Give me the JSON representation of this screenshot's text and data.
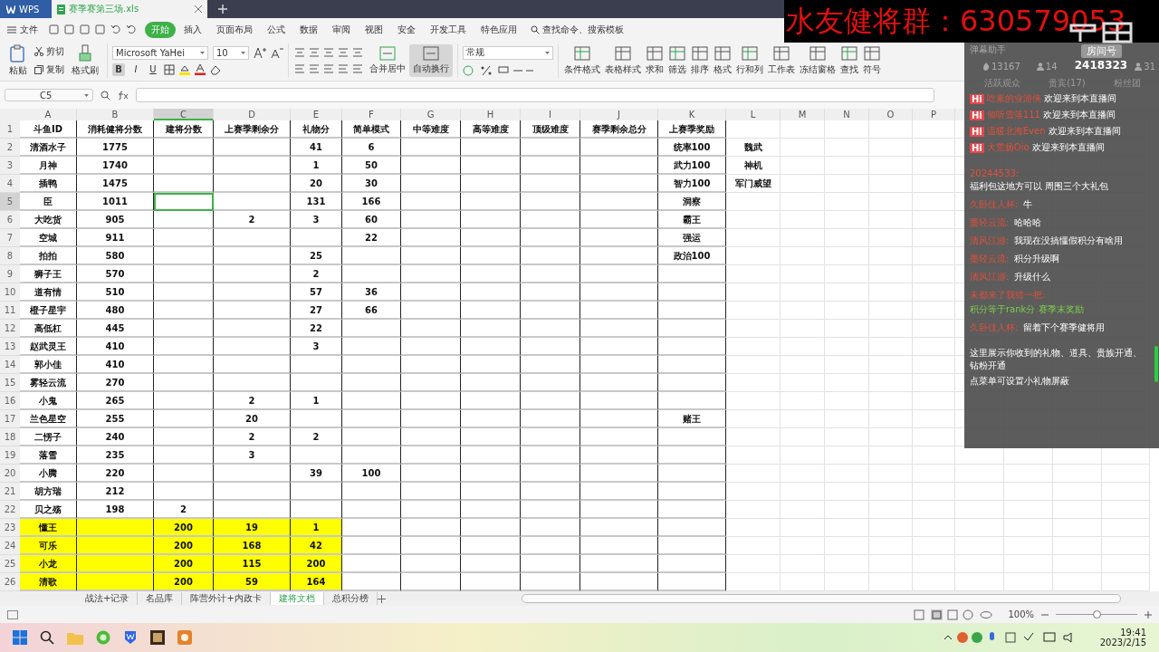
{
  "tabs": {
    "app": "WPS",
    "file": "赛季赛第三场.xls"
  },
  "banner": "水友健将群：630579053",
  "menu": {
    "file": "文件",
    "items": [
      {
        "label": "开始",
        "selected": true
      },
      {
        "label": "插入",
        "selected": false
      },
      {
        "label": "页面布局",
        "selected": false
      },
      {
        "label": "公式",
        "selected": false
      },
      {
        "label": "数据",
        "selected": false
      },
      {
        "label": "审阅",
        "selected": false
      },
      {
        "label": "视图",
        "selected": false
      },
      {
        "label": "安全",
        "selected": false
      },
      {
        "label": "开发工具",
        "selected": false
      },
      {
        "label": "特色应用",
        "selected": false
      }
    ],
    "search": "查找命令、搜索模板"
  },
  "ribbon": {
    "paste": "粘贴",
    "cut": "剪切",
    "copy": "复制",
    "format_painter": "格式刷",
    "font": "Microsoft YaHei",
    "size": "10",
    "format_buttons": [
      {
        "label": "B",
        "pressed": true
      },
      {
        "label": "I",
        "pressed": false
      },
      {
        "label": "U",
        "pressed": false
      }
    ],
    "align_buttons": [
      {
        "label": "合并居中",
        "pressed": false
      },
      {
        "label": "自动换行",
        "pressed": true
      }
    ],
    "number_format": "常规",
    "tools": [
      "条件格式",
      "表格样式",
      "求和",
      "筛选",
      "排序",
      "格式",
      "行和列",
      "工作表",
      "冻结窗格",
      "查找",
      "符号"
    ]
  },
  "formula_bar": {
    "name_box": "C5"
  },
  "sheet": {
    "columns": [
      {
        "letter": "A",
        "selected": false
      },
      {
        "letter": "B",
        "selected": false
      },
      {
        "letter": "C",
        "selected": true
      },
      {
        "letter": "D",
        "selected": false
      },
      {
        "letter": "E",
        "selected": false
      },
      {
        "letter": "F",
        "selected": false
      },
      {
        "letter": "G",
        "selected": false
      },
      {
        "letter": "H",
        "selected": false
      },
      {
        "letter": "I",
        "selected": false
      },
      {
        "letter": "J",
        "selected": false
      },
      {
        "letter": "K",
        "selected": false
      },
      {
        "letter": "L",
        "selected": false
      },
      {
        "letter": "M",
        "selected": false
      },
      {
        "letter": "N",
        "selected": false
      },
      {
        "letter": "O",
        "selected": false
      },
      {
        "letter": "P",
        "selected": false
      }
    ],
    "rows": [
      {
        "number": "1",
        "selected": false,
        "highlighted": false,
        "cells": {
          "A": "斗鱼ID",
          "B": "消耗健将分数",
          "C": "建将分数",
          "D": "上赛季剩余分",
          "E": "礼物分",
          "F": "简单模式",
          "G": "中等难度",
          "H": "高等难度",
          "I": "顶级难度",
          "J": "赛季剩余总分",
          "K": "上赛季奖励"
        }
      },
      {
        "number": "2",
        "selected": false,
        "highlighted": false,
        "cells": {
          "A": "清酒水子",
          "B": "1775",
          "E": "41",
          "F": "6",
          "K": "统率100",
          "L": "魏武"
        }
      },
      {
        "number": "3",
        "selected": false,
        "highlighted": false,
        "cells": {
          "A": "月神",
          "B": "1740",
          "E": "1",
          "F": "50",
          "K": "武力100",
          "L": "神机"
        }
      },
      {
        "number": "4",
        "selected": false,
        "highlighted": false,
        "cells": {
          "A": "插鸭",
          "B": "1475",
          "E": "20",
          "F": "30",
          "K": "智力100",
          "L": "军门威望"
        }
      },
      {
        "number": "5",
        "selected": true,
        "highlighted": false,
        "cells": {
          "A": "臣",
          "B": "1011",
          "E": "131",
          "F": "166",
          "K": "洞察"
        }
      },
      {
        "number": "6",
        "selected": false,
        "highlighted": false,
        "cells": {
          "A": "大吃货",
          "B": "905",
          "D": "2",
          "E": "3",
          "F": "60",
          "K": "霸王"
        }
      },
      {
        "number": "7",
        "selected": false,
        "highlighted": false,
        "cells": {
          "A": "空城",
          "B": "911",
          "F": "22",
          "K": "强运"
        }
      },
      {
        "number": "8",
        "selected": false,
        "highlighted": false,
        "cells": {
          "A": "拍拍",
          "B": "580",
          "E": "25",
          "K": "政治100"
        }
      },
      {
        "number": "9",
        "selected": false,
        "highlighted": false,
        "cells": {
          "A": "狮子王",
          "B": "570",
          "E": "2"
        }
      },
      {
        "number": "10",
        "selected": false,
        "highlighted": false,
        "cells": {
          "A": "道有情",
          "B": "510",
          "E": "57",
          "F": "36"
        }
      },
      {
        "number": "11",
        "selected": false,
        "highlighted": false,
        "cells": {
          "A": "橙子星宇",
          "B": "480",
          "E": "27",
          "F": "66"
        }
      },
      {
        "number": "12",
        "selected": false,
        "highlighted": false,
        "cells": {
          "A": "高低杠",
          "B": "445",
          "E": "22"
        }
      },
      {
        "number": "13",
        "selected": false,
        "highlighted": false,
        "cells": {
          "A": "赵武灵王",
          "B": "410",
          "E": "3"
        }
      },
      {
        "number": "14",
        "selected": false,
        "highlighted": false,
        "cells": {
          "A": "郭小佳",
          "B": "410"
        }
      },
      {
        "number": "15",
        "selected": false,
        "highlighted": false,
        "cells": {
          "A": "雾轻云流",
          "B": "270"
        }
      },
      {
        "number": "16",
        "selected": false,
        "highlighted": false,
        "cells": {
          "A": "小鬼",
          "B": "265",
          "D": "2",
          "E": "1"
        }
      },
      {
        "number": "17",
        "selected": false,
        "highlighted": false,
        "cells": {
          "A": "兰色星空",
          "B": "255",
          "D": "20",
          "K": "赌王"
        }
      },
      {
        "number": "18",
        "selected": false,
        "highlighted": false,
        "cells": {
          "A": "二愣子",
          "B": "240",
          "D": "2",
          "E": "2"
        }
      },
      {
        "number": "19",
        "selected": false,
        "highlighted": false,
        "cells": {
          "A": "落雪",
          "B": "235",
          "D": "3"
        }
      },
      {
        "number": "20",
        "selected": false,
        "highlighted": false,
        "cells": {
          "A": "小腾",
          "B": "220",
          "E": "39",
          "F": "100"
        }
      },
      {
        "number": "21",
        "selected": false,
        "highlighted": false,
        "cells": {
          "A": "胡方瑞",
          "B": "212"
        }
      },
      {
        "number": "22",
        "selected": false,
        "highlighted": false,
        "cells": {
          "A": "贝之殇",
          "B": "198",
          "C": "2"
        }
      },
      {
        "number": "23",
        "selected": false,
        "highlighted": true,
        "cells": {
          "A": "懂王",
          "C": "200",
          "D": "19",
          "E": "1"
        }
      },
      {
        "number": "24",
        "selected": false,
        "highlighted": true,
        "cells": {
          "A": "可乐",
          "C": "200",
          "D": "168",
          "E": "42"
        }
      },
      {
        "number": "25",
        "selected": false,
        "highlighted": true,
        "cells": {
          "A": "小龙",
          "C": "200",
          "D": "115",
          "E": "200"
        }
      },
      {
        "number": "26",
        "selected": false,
        "highlighted": true,
        "cells": {
          "A": "清歌",
          "C": "200",
          "D": "59",
          "E": "164"
        }
      }
    ]
  },
  "sheet_tabs": [
    {
      "label": "战法+记录",
      "selected": false
    },
    {
      "label": "名品库",
      "selected": false
    },
    {
      "label": "阵营外计+内政卡",
      "selected": false
    },
    {
      "label": "建将文档",
      "selected": true
    },
    {
      "label": "总积分榜",
      "selected": false
    }
  ],
  "status": {
    "zoom": "100%",
    "level": 0.5
  },
  "chat": {
    "title": "弹幕助手",
    "stats": [
      "13167",
      "14",
      "31"
    ],
    "tabs": [
      "活跃观众",
      "贵宾(17)",
      "粉丝团"
    ],
    "room_label": "房间号",
    "room_id": "2418323",
    "welcomes": [
      {
        "badge": "Hi",
        "name": "吃素的业游侠",
        "text": "欢迎来到本直播间"
      },
      {
        "badge": "Hi",
        "name": "倾听雪落111",
        "text": "欢迎来到本直播间"
      },
      {
        "badge": "Hi",
        "name": "温暖北海Even",
        "text": "欢迎来到本直播间"
      },
      {
        "badge": "Hi",
        "name": "大荒扬Oio",
        "text": "欢迎来到本直播间"
      }
    ],
    "messages": [
      {
        "name": "20244533:",
        "text": "福利包这地方可以 周围三个大礼包",
        "highlight": false
      },
      {
        "name": "久卧佳人杯:",
        "text": "牛",
        "highlight": false
      },
      {
        "name": "墨轻云流:",
        "text": "哈哈哈",
        "highlight": false
      },
      {
        "name": "清风江游:",
        "text": "我现在没搞懂假积分有啥用",
        "highlight": false
      },
      {
        "name": "墨轻云流:",
        "text": "积分升级啊",
        "highlight": false
      },
      {
        "name": "清风江游:",
        "text": "升级什么",
        "highlight": false
      },
      {
        "name": "未都来了我猜一把:",
        "text": "积分等于rank分 赛季末奖励",
        "highlight": true
      },
      {
        "name": "久卧佳人杯:",
        "text": "留着下个赛季健将用",
        "highlight": false
      }
    ],
    "notice": [
      "这里展示你收到的礼物、道具、贵族开通、钻粉开通",
      "点菜单可设置小礼物屏蔽"
    ]
  },
  "taskbar": {
    "time": "19:41",
    "date": "2023/2/15"
  }
}
